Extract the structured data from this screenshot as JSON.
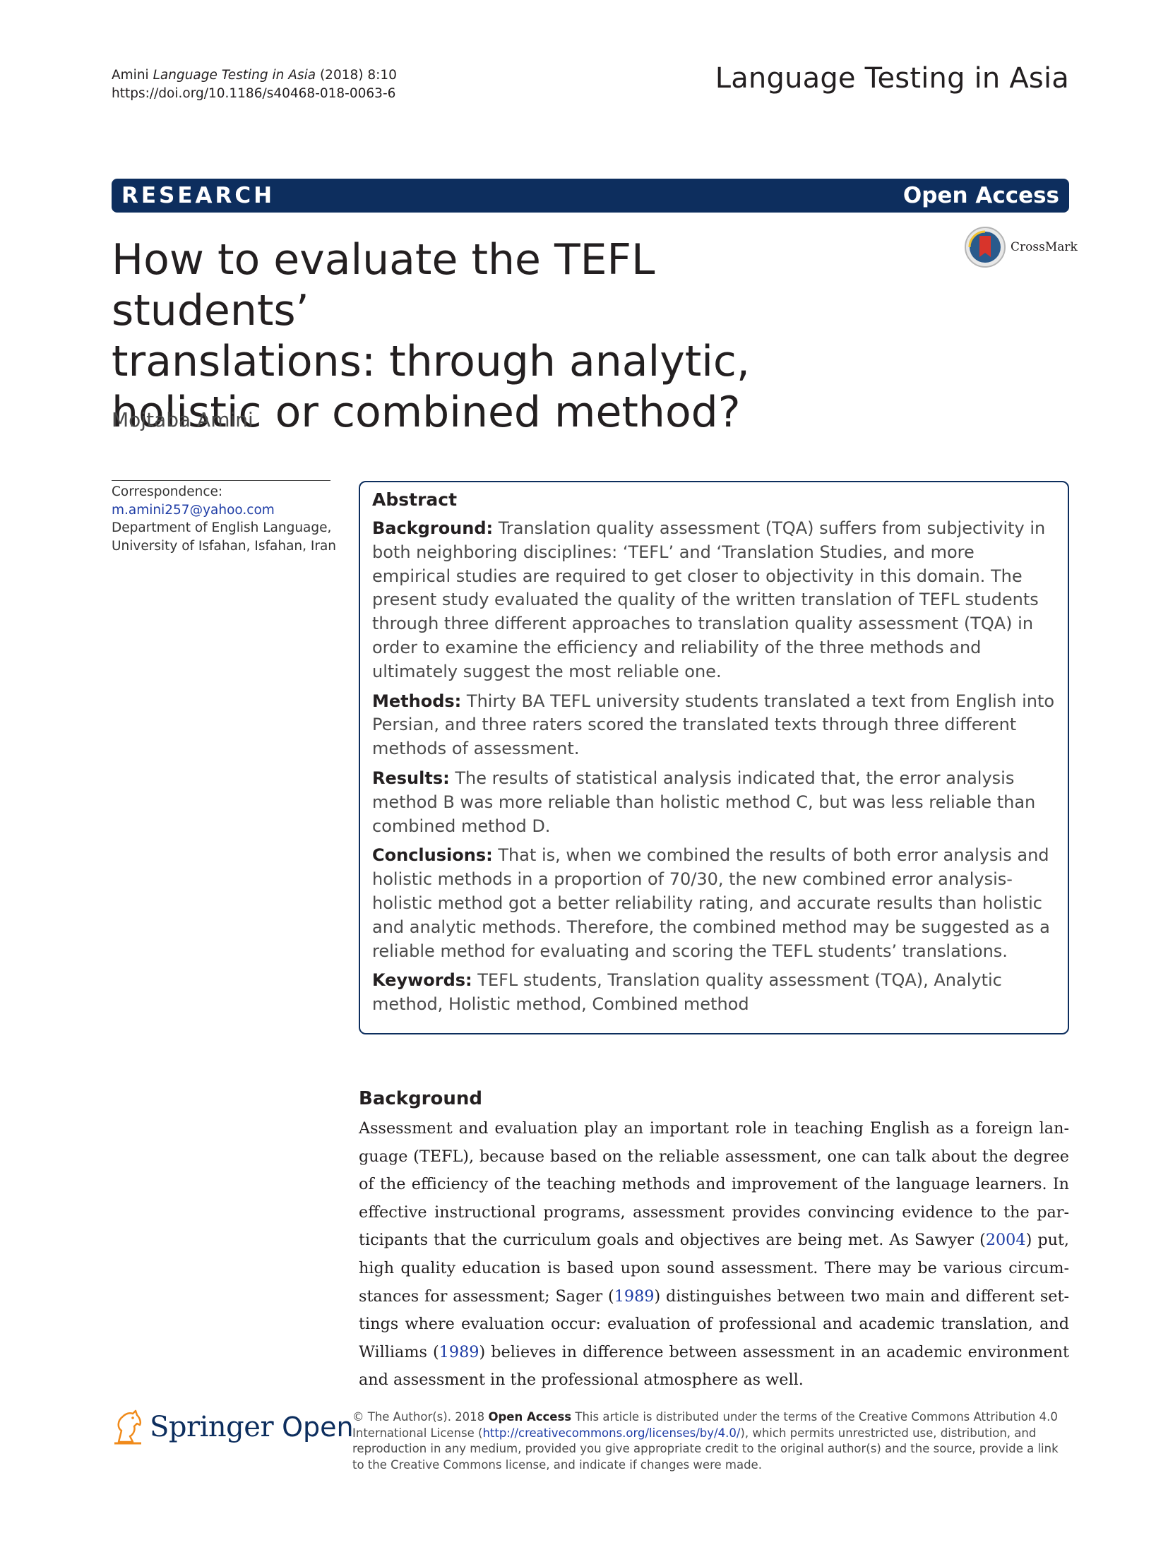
{
  "header": {
    "author_short": "Amini",
    "journal_italic": "Language Testing in Asia",
    "year_volume": "(2018) 8:10",
    "doi": "https://doi.org/10.1186/s40468-018-0063-6",
    "journal_name": "Language Testing in Asia"
  },
  "banner": {
    "article_type": "RESEARCH",
    "access": "Open Access"
  },
  "crossmark_label": "CrossMark",
  "title": {
    "line1": "How to evaluate the TEFL students’",
    "line2": "translations: through analytic,",
    "line3": "holistic or combined method?"
  },
  "author": "Mojtaba Amini",
  "correspondence": {
    "label": "Correspondence:",
    "email": "m.amini257@yahoo.com",
    "affil1": "Department of English Language,",
    "affil2": "University of Isfahan, Isfahan, Iran"
  },
  "abstract": {
    "heading": "Abstract",
    "background_label": "Background:",
    "background_text": " Translation quality assessment (TQA) suffers from subjectivity in both neighboring disciplines: ‘TEFL’ and ‘Translation Studies, and more empirical studies are required to get closer to objectivity in this domain. The present study evaluated the quality of the written translation of TEFL students through three different approaches to translation quality assessment (TQA) in order to examine the efficiency and reliability of the three methods and ultimately suggest the most reliable one.",
    "methods_label": "Methods:",
    "methods_text": " Thirty BA TEFL university students translated a text from English into Persian, and three raters scored the translated texts through three different methods of assessment.",
    "results_label": "Results:",
    "results_text": " The results of statistical analysis indicated that, the error analysis method B was more reliable than holistic method C, but was less reliable than combined method D.",
    "conclusions_label": "Conclusions:",
    "conclusions_text": " That is, when we combined the results of both error analysis and holistic methods in a proportion of 70/30, the new combined error analysis-holistic method got a better reliability rating, and accurate results than holistic and analytic methods. Therefore, the combined method may be suggested as a reliable method for evaluating and scoring the TEFL students’ translations.",
    "keywords_label": "Keywords:",
    "keywords_text": " TEFL students, Translation quality assessment (TQA), Analytic method, Holistic method, Combined method"
  },
  "body": {
    "heading": "Background",
    "p1_a": "Assessment and evaluation play an important role in teaching English as a foreign lan-guage (TEFL), because based on the reliable assessment, one can talk about the degree of the efficiency of the teaching methods and improvement of the language learners. In effective instructional programs, assessment provides convincing evidence to the par-ticipants that the curriculum goals and objectives are being met. As Sawyer (",
    "cite1": "2004",
    "p1_b": ") put, high quality education is based upon sound assessment. There may be various circum-stances for assessment; Sager (",
    "cite2": "1989",
    "p1_c": ") distinguishes between two main and different set-tings where evaluation occur: evaluation of professional and academic translation, and Williams (",
    "cite3": "1989",
    "p1_d": ") believes in difference between assessment in an academic environment and assessment in the professional atmosphere as well."
  },
  "footer": {
    "brand1": "Springer",
    "brand2": "Open",
    "copyright": "© The Author(s). 2018 ",
    "open_access": "Open Access",
    "license_a": " This article is distributed under the terms of the Creative Commons Attribution 4.0 International License (",
    "license_url": "http://creativecommons.org/licenses/by/4.0/",
    "license_b": "), which permits unrestricted use, distribution, and reproduction in any medium, provided you give appropriate credit to the original author(s) and the source, provide a link to the Creative Commons license, and indicate if changes were made."
  },
  "colors": {
    "banner": "#0d2e5e",
    "link": "#1f3da6"
  }
}
